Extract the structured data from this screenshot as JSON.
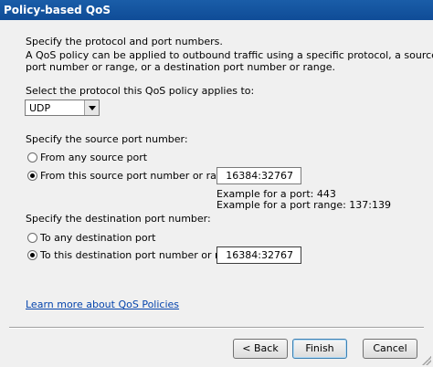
{
  "window": {
    "title": "Policy-based QoS"
  },
  "intro": {
    "heading": "Specify the protocol and port numbers.",
    "desc_line1": "A QoS policy can be applied to outbound traffic using a specific protocol, a source",
    "desc_line2": "port number or range, or a destination port number or range."
  },
  "protocol": {
    "label": "Select the protocol this QoS policy applies to:",
    "selected": "UDP"
  },
  "source": {
    "label": "Specify the source port number:",
    "option_any": "From any source port",
    "option_specific": "From this source port number or range:",
    "selected": "specific",
    "value": "16384:32767",
    "example_port": "Example for a port: 443",
    "example_range": "Example for a port range: 137:139"
  },
  "destination": {
    "label": "Specify the destination port number:",
    "option_any": "To any destination port",
    "option_specific": "To this destination port number or range:",
    "selected": "specific",
    "value": "16384:32767"
  },
  "learn_more": "Learn more about QoS Policies",
  "buttons": {
    "back": "< Back",
    "finish": "Finish",
    "cancel": "Cancel"
  }
}
